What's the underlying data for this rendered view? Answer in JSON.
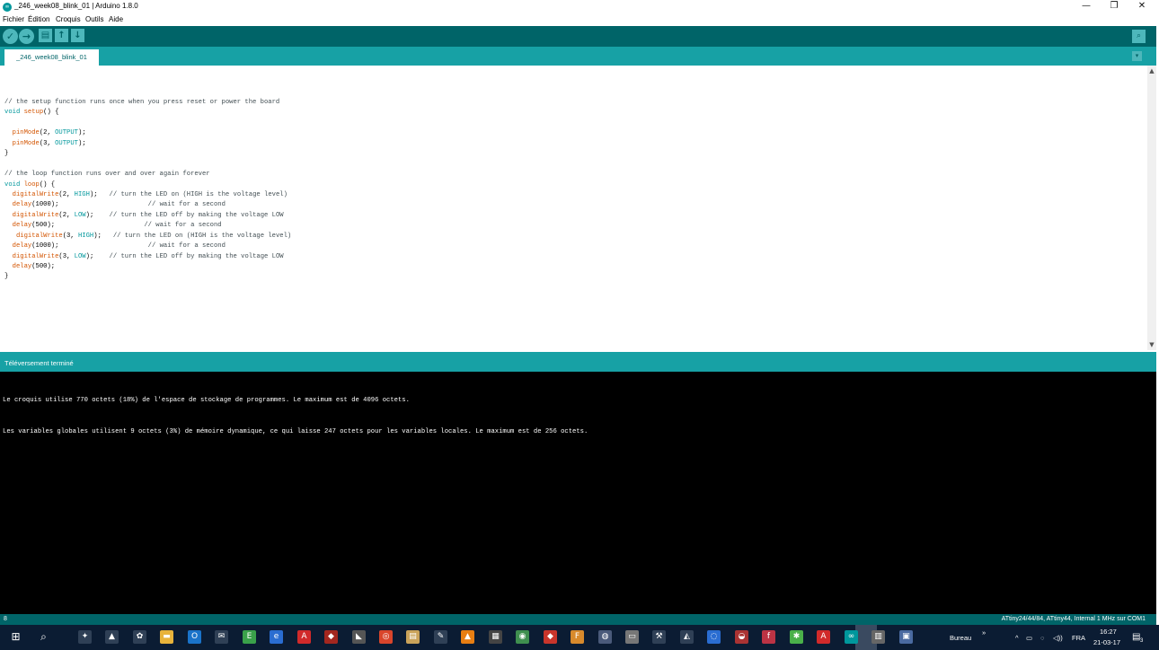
{
  "window": {
    "title": "_246_week08_blink_01 | Arduino 1.8.0",
    "logo_glyph": "∞",
    "minimize_glyph": "—",
    "maximize_glyph": "❐",
    "close_glyph": "✕"
  },
  "menu": [
    "Fichier",
    "Édition",
    "Croquis",
    "Outils",
    "Aide"
  ],
  "toolbar": {
    "verify_glyph": "✓",
    "upload_glyph": "→",
    "new_glyph": "▤",
    "open_glyph": "↑",
    "save_glyph": "↓",
    "serial_glyph": "⌕"
  },
  "tabs": {
    "active": "_246_week08_blink_01",
    "menu_glyph": "▾"
  },
  "code_lines": [
    [
      {
        "t": "// the setup function runs once when you press reset or power the board",
        "c": "com"
      }
    ],
    [
      {
        "t": "void",
        "c": "kw"
      },
      {
        "t": " "
      },
      {
        "t": "setup",
        "c": "fn"
      },
      {
        "t": "() {"
      }
    ],
    [
      {
        "t": ""
      }
    ],
    [
      {
        "t": "  "
      },
      {
        "t": "pinMode",
        "c": "fn"
      },
      {
        "t": "(2, "
      },
      {
        "t": "OUTPUT",
        "c": "const"
      },
      {
        "t": ");"
      }
    ],
    [
      {
        "t": "  "
      },
      {
        "t": "pinMode",
        "c": "fn"
      },
      {
        "t": "(3, "
      },
      {
        "t": "OUTPUT",
        "c": "const"
      },
      {
        "t": ");"
      }
    ],
    [
      {
        "t": "}"
      }
    ],
    [
      {
        "t": ""
      }
    ],
    [
      {
        "t": "// the loop function runs over and over again forever",
        "c": "com"
      }
    ],
    [
      {
        "t": "void",
        "c": "kw"
      },
      {
        "t": " "
      },
      {
        "t": "loop",
        "c": "fn"
      },
      {
        "t": "() {"
      }
    ],
    [
      {
        "t": "  "
      },
      {
        "t": "digitalWrite",
        "c": "fn"
      },
      {
        "t": "(2, "
      },
      {
        "t": "HIGH",
        "c": "const"
      },
      {
        "t": ");   "
      },
      {
        "t": "// turn the LED on (HIGH is the voltage level)",
        "c": "com"
      }
    ],
    [
      {
        "t": "  "
      },
      {
        "t": "delay",
        "c": "fn"
      },
      {
        "t": "(1000);                       "
      },
      {
        "t": "// wait for a second",
        "c": "com"
      }
    ],
    [
      {
        "t": "  "
      },
      {
        "t": "digitalWrite",
        "c": "fn"
      },
      {
        "t": "(2, "
      },
      {
        "t": "LOW",
        "c": "const"
      },
      {
        "t": ");    "
      },
      {
        "t": "// turn the LED off by making the voltage LOW",
        "c": "com"
      }
    ],
    [
      {
        "t": "  "
      },
      {
        "t": "delay",
        "c": "fn"
      },
      {
        "t": "(500);                       "
      },
      {
        "t": "// wait for a second",
        "c": "com"
      }
    ],
    [
      {
        "t": "   "
      },
      {
        "t": "digitalWrite",
        "c": "fn"
      },
      {
        "t": "(3, "
      },
      {
        "t": "HIGH",
        "c": "const"
      },
      {
        "t": ");   "
      },
      {
        "t": "// turn the LED on (HIGH is the voltage level)",
        "c": "com"
      }
    ],
    [
      {
        "t": "  "
      },
      {
        "t": "delay",
        "c": "fn"
      },
      {
        "t": "(1000);                       "
      },
      {
        "t": "// wait for a second",
        "c": "com"
      }
    ],
    [
      {
        "t": "  "
      },
      {
        "t": "digitalWrite",
        "c": "fn"
      },
      {
        "t": "(3, "
      },
      {
        "t": "LOW",
        "c": "const"
      },
      {
        "t": ");    "
      },
      {
        "t": "// turn the LED off by making the voltage LOW",
        "c": "com"
      }
    ],
    [
      {
        "t": "  "
      },
      {
        "t": "delay",
        "c": "fn"
      },
      {
        "t": "(500);"
      }
    ],
    [
      {
        "t": "}"
      }
    ]
  ],
  "status": {
    "message": "Téléversement terminé"
  },
  "console": [
    "Le croquis utilise 770 octets (18%) de l'espace de stockage de programmes. Le maximum est de 4096 octets.",
    "Les variables globales utilisent 9 octets (3%) de mémoire dynamique, ce qui laisse 247 octets pour les variables locales. Le maximum est de 256 octets."
  ],
  "footer": {
    "line_number": "8",
    "board": "ATtiny24/44/84, ATtiny44, Internal 1 MHz sur COM1"
  },
  "taskbar": {
    "start_glyph": "⊞",
    "search_glyph": "⌕",
    "icons": [
      {
        "name": "cortana-icon",
        "glyph": "✦",
        "bg": "#2f4056"
      },
      {
        "name": "photos-icon",
        "glyph": "▲",
        "bg": "#2f4056"
      },
      {
        "name": "agent-icon",
        "glyph": "✿",
        "bg": "#2f4056"
      },
      {
        "name": "file-explorer-icon",
        "glyph": "▬",
        "bg": "#e8b33b"
      },
      {
        "name": "outlook-icon",
        "glyph": "O",
        "bg": "#1a73c9"
      },
      {
        "name": "mail-icon",
        "glyph": "✉",
        "bg": "#2f4056"
      },
      {
        "name": "evernote-icon",
        "glyph": "E",
        "bg": "#3aa14a"
      },
      {
        "name": "edge-icon",
        "glyph": "e",
        "bg": "#2a6dd1"
      },
      {
        "name": "acrobat-icon",
        "glyph": "A",
        "bg": "#d12a2a"
      },
      {
        "name": "cube-app-icon",
        "glyph": "◆",
        "bg": "#a3271f"
      },
      {
        "name": "inkscape-icon",
        "glyph": "◣",
        "bg": "#555"
      },
      {
        "name": "chrome-icon",
        "glyph": "◎",
        "bg": "#d9452b"
      },
      {
        "name": "notepad-icon",
        "glyph": "▤",
        "bg": "#caa35a"
      },
      {
        "name": "pen-tool-icon",
        "glyph": "✎",
        "bg": "#2f4056"
      },
      {
        "name": "vlc-icon",
        "glyph": "▲",
        "bg": "#e87e12"
      },
      {
        "name": "calculator-icon",
        "glyph": "▦",
        "bg": "#444"
      },
      {
        "name": "globe-app-icon",
        "glyph": "◉",
        "bg": "#3f8f4f"
      },
      {
        "name": "git-icon",
        "glyph": "◆",
        "bg": "#c9352b"
      },
      {
        "name": "f-app-icon",
        "glyph": "F",
        "bg": "#d88a2c"
      },
      {
        "name": "steam-icon",
        "glyph": "◍",
        "bg": "#4a5a7a"
      },
      {
        "name": "keyboard-app-icon",
        "glyph": "▭",
        "bg": "#777"
      },
      {
        "name": "tool-app-icon",
        "glyph": "⚒",
        "bg": "#2f4056"
      },
      {
        "name": "navigation-app-icon",
        "glyph": "◭",
        "bg": "#2f4056"
      },
      {
        "name": "sync-app-icon",
        "glyph": "◌",
        "bg": "#2a6dd1"
      },
      {
        "name": "eye-app-icon",
        "glyph": "◒",
        "bg": "#a33"
      },
      {
        "name": "fritzing-icon",
        "glyph": "f",
        "bg": "#b34"
      },
      {
        "name": "leaf-app-icon",
        "glyph": "✱",
        "bg": "#4ab04a"
      },
      {
        "name": "autodesk-icon",
        "glyph": "A",
        "bg": "#d12a2a"
      },
      {
        "name": "arduino-taskbar-icon",
        "glyph": "∞",
        "bg": "#00979c"
      },
      {
        "name": "printer-app-icon",
        "glyph": "▥",
        "bg": "#666"
      },
      {
        "name": "remote-app-icon",
        "glyph": "▣",
        "bg": "#4a6aa0"
      }
    ],
    "desktop_label": "Bureau",
    "overflow_glyph": "»",
    "tray_glyphs": [
      "^",
      "▭",
      "◌",
      "◁))"
    ],
    "language": "FRA",
    "time": "16:27",
    "date": "21-03-17",
    "notification_count": "3",
    "notification_glyph": "▤"
  }
}
